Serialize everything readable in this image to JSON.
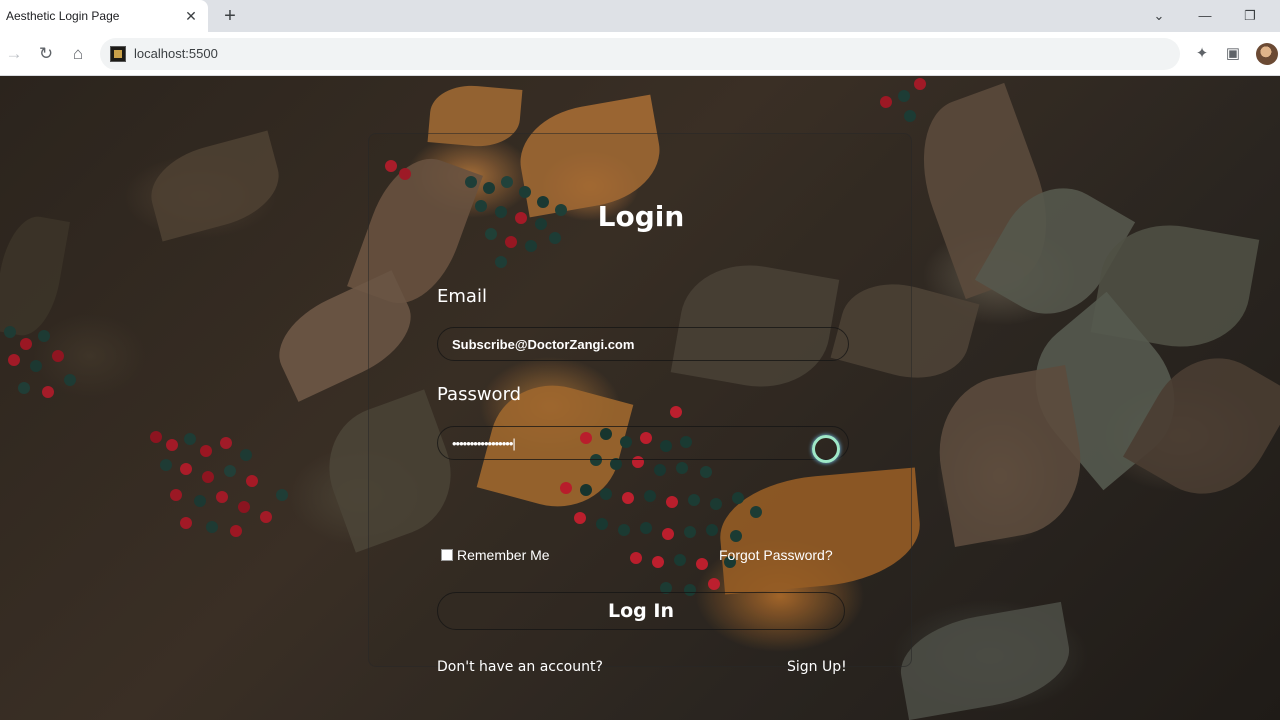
{
  "browser": {
    "tab_title": "Aesthetic Login Page",
    "tab_close": "✕",
    "new_tab": "+",
    "url": "localhost:5500",
    "window_controls": {
      "dropdown": "⌄",
      "minimize": "—",
      "restore": "❐"
    }
  },
  "login": {
    "title": "Login",
    "email_label": "Email",
    "email_value": "Subscribe@DoctorZangi.com",
    "password_label": "Password",
    "password_value": "•••••••••••••••••|",
    "remember_label": "Remember Me",
    "forgot_label": "Forgot Password?",
    "login_button": "Log In",
    "no_account_text": "Don't have an account?",
    "signup_label": "Sign Up!"
  },
  "colors": {
    "text": "#ffffff",
    "focus_ring": "#9fe8c8"
  }
}
